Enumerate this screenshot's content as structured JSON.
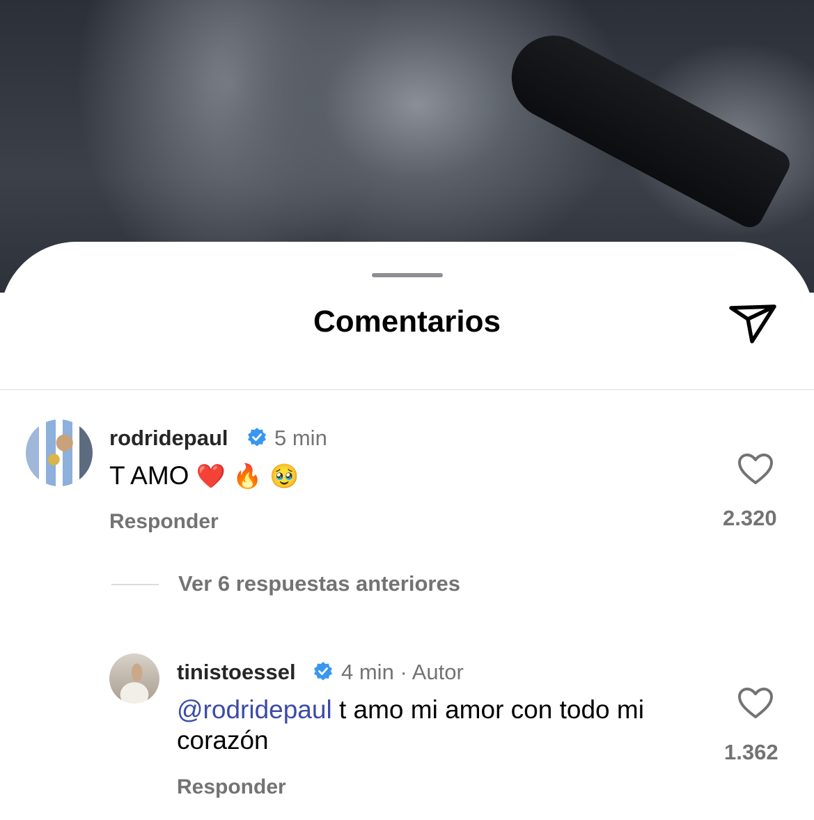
{
  "header": {
    "title": "Comentarios"
  },
  "icons": {
    "share": "paper-plane-icon",
    "like": "heart-outline-icon",
    "verified": "verified-badge-icon"
  },
  "colors": {
    "verified": "#3897f0",
    "mention": "#3b4ba8",
    "secondary_text": "#737373"
  },
  "comments": [
    {
      "username": "rodridepaul",
      "time": "5 min",
      "text": "T AMO",
      "emojis": [
        "❤️",
        "🔥",
        "🥹"
      ],
      "reply_label": "Responder",
      "likes": "2.320"
    }
  ],
  "thread": {
    "view_more": "Ver 6 respuestas anteriores"
  },
  "replies": [
    {
      "username": "tinistoessel",
      "time": "4 min",
      "separator": "·",
      "author_label": "Autor",
      "mention": "@rodridepaul",
      "text_line1": " t amo mi amor con todo mi",
      "text_line2": "corazón",
      "reply_label": "Responder",
      "likes": "1.362"
    }
  ]
}
